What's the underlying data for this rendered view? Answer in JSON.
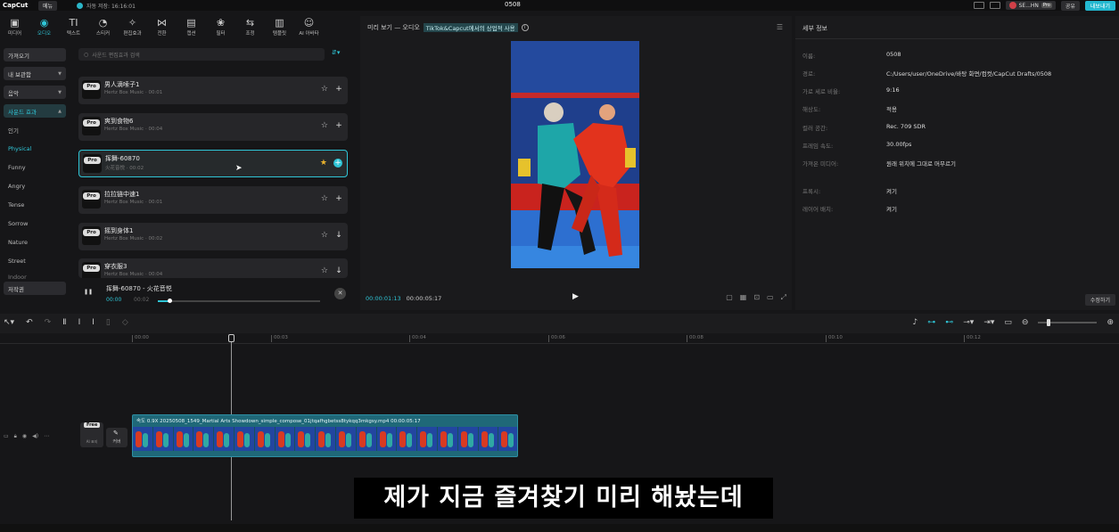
{
  "app": {
    "logo": "CapCut",
    "menu": "메뉴",
    "autosave": "자동 저장: 16:16:01",
    "project": "0508"
  },
  "top_right": {
    "user": "SE...HN",
    "pro": "Pro",
    "share": "공유",
    "export": "내보내기"
  },
  "toolbar": [
    {
      "icon": "media-icon",
      "glyph": "▣",
      "label": "미디어"
    },
    {
      "icon": "audio-icon",
      "glyph": "◉",
      "label": "오디오"
    },
    {
      "icon": "text-icon",
      "glyph": "TI",
      "label": "텍스트"
    },
    {
      "icon": "sticker-icon",
      "glyph": "◔",
      "label": "스티커"
    },
    {
      "icon": "effects-icon",
      "glyph": "✧",
      "label": "편집효과"
    },
    {
      "icon": "transition-icon",
      "glyph": "⋈",
      "label": "전환"
    },
    {
      "icon": "caption-icon",
      "glyph": "▤",
      "label": "캡션"
    },
    {
      "icon": "filter-icon",
      "glyph": "❀",
      "label": "필터"
    },
    {
      "icon": "adjust-icon",
      "glyph": "⇆",
      "label": "조정"
    },
    {
      "icon": "template-icon",
      "glyph": "▥",
      "label": "템플릿"
    },
    {
      "icon": "ai-avatar-icon",
      "glyph": "☺",
      "label": "AI 아바타"
    }
  ],
  "categories": {
    "import": "가져오기",
    "library": "내 보관함",
    "music": "음악",
    "sound_effects": "사운드 효과",
    "popular": "인기",
    "physical": "Physical",
    "funny": "Funny",
    "angry": "Angry",
    "tense": "Tense",
    "sorrow": "Sorrow",
    "nature": "Nature",
    "street": "Street",
    "indoor": "Indoor",
    "copyright": "저작권"
  },
  "search_placeholder": "사운드 편집효과 검색",
  "sounds": [
    {
      "name": "男人滴嗦子1",
      "sub": "Hertz Box Music · 00:01",
      "fav": false,
      "action": "+"
    },
    {
      "name": "爽到食物6",
      "sub": "Hertz Box Music · 00:04",
      "fav": false,
      "action": "+"
    },
    {
      "name": "挥舞-60870",
      "sub": "火花音悦 · 00:02",
      "fav": true,
      "action": "+"
    },
    {
      "name": "拉拉链中速1",
      "sub": "Hertz Box Music · 00:01",
      "fav": false,
      "action": "+"
    },
    {
      "name": "摇到身体1",
      "sub": "Hertz Box Music · 00:02",
      "fav": false,
      "action": "↓"
    },
    {
      "name": "穿衣服3",
      "sub": "Hertz Box Music · 00:04",
      "fav": false,
      "action": "↓"
    }
  ],
  "pro_badge": "Pro",
  "player": {
    "name": "挥舞-60870 - 火花音悦",
    "time": "00:00",
    "duration": "00:02",
    "progress": 0.07
  },
  "preview": {
    "title": "미리 보기 — 오디오",
    "highlight": "TikTok&Capcut에서의 상업적 사용",
    "current": "00:00:01:13",
    "total": "00:00:05:17"
  },
  "details": {
    "title": "세부 정보",
    "rows": [
      {
        "k": "이름:",
        "v": "0508"
      },
      {
        "k": "경로:",
        "v": "C:/Users/user/OneDrive/바탕 화면/컴컷/CapCut Drafts/0508"
      },
      {
        "k": "가로 세로 비율:",
        "v": "9:16"
      },
      {
        "k": "해상도:",
        "v": "적용"
      },
      {
        "k": "컬러 공간:",
        "v": "Rec. 709 SDR"
      },
      {
        "k": "프레임 속도:",
        "v": "30.00fps"
      },
      {
        "k": "가져온 미디어:",
        "v": "원래 위치에 그대로 머무르기"
      },
      {
        "k": "프록시:",
        "v": "켜기"
      },
      {
        "k": "레이어 배치:",
        "v": "켜기"
      }
    ],
    "edit": "수정하기"
  },
  "ruler": [
    "00:00",
    "00:03",
    "00:04",
    "00:06",
    "00:08",
    "00:10",
    "00:12"
  ],
  "track": {
    "free": "Free",
    "cover_tag": "AI 표지",
    "cover": "커버"
  },
  "clip": {
    "label": "속도 0.9X   20250508_1549_Martial Arts Showdown_simple_compose_01jtqafhgbetss8tykqq3mkgsy.mp4   00:00:05:17"
  },
  "subtitle": "제가 지금 즐겨찾기 미리 해놨는데",
  "colors": {
    "accent": "#2fc5d6",
    "favorite": "#e8b22e",
    "export": "#23b8d0"
  }
}
